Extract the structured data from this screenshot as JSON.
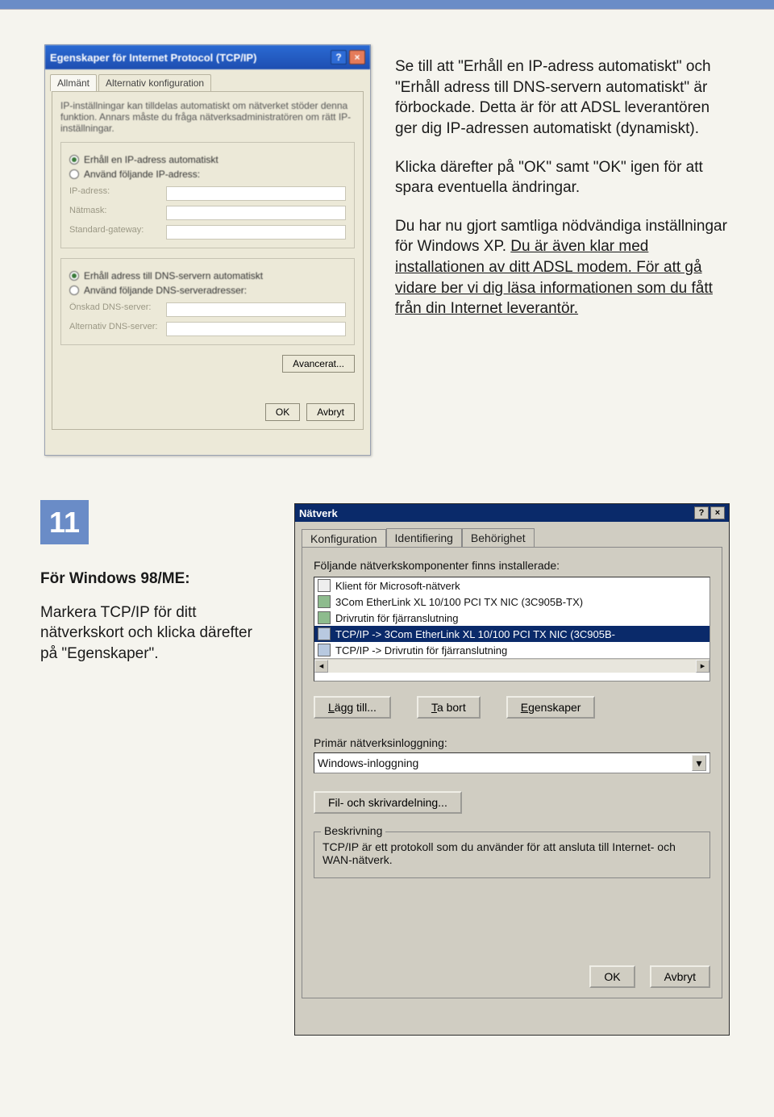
{
  "topbar": {},
  "xp": {
    "title": "Egenskaper för Internet Protocol (TCP/IP)",
    "tab_general": "Allmänt",
    "tab_alt": "Alternativ konfiguration",
    "blurb": "IP-inställningar kan tilldelas automatiskt om nätverket stöder denna funktion. Annars måste du fråga nätverksadministratören om rätt IP-inställningar.",
    "r_ip_auto": "Erhåll en IP-adress automatiskt",
    "r_ip_manual": "Använd följande IP-adress:",
    "lbl_ip": "IP-adress:",
    "lbl_mask": "Nätmask:",
    "lbl_gw": "Standard-gateway:",
    "r_dns_auto": "Erhåll adress till DNS-servern automatiskt",
    "r_dns_manual": "Använd följande DNS-serveradresser:",
    "lbl_dns1": "Önskad DNS-server:",
    "lbl_dns2": "Alternativ DNS-server:",
    "btn_adv": "Avancerat...",
    "btn_ok": "OK",
    "btn_cancel": "Avbryt"
  },
  "rtxt1": {
    "p1": "Se till att \"Erhåll en IP-adress automatiskt\" och \"Erhåll adress till DNS-servern automatiskt\" är förbockade. Detta är för att ADSL leverantören ger dig IP-adressen automatiskt (dynamiskt).",
    "p2": "Klicka därefter på \"OK\" samt \"OK\" igen för att spara eventuella ändringar.",
    "p3a": "Du har nu gjort samtliga nödvändiga inställningar för Windows XP. ",
    "p3b": "Du är även klar med installationen av ditt ADSL modem.",
    "p3c": " För att gå vidare ber vi dig läsa informationen som du fått från din Internet leverantör."
  },
  "step": {
    "num": "11"
  },
  "ltxt2": {
    "heading": "För Windows 98/ME:",
    "body": "Markera TCP/IP för ditt nätverkskort och klicka därefter på \"Egenskaper\"."
  },
  "w98": {
    "title": "Nätverk",
    "tab_conf": "Konfiguration",
    "tab_id": "Identifiering",
    "tab_sec": "Behörighet",
    "label_components": "Följande nätverkskomponenter finns installerade:",
    "items": [
      "Klient för Microsoft-nätverk",
      "3Com EtherLink XL 10/100 PCI TX NIC (3C905B-TX)",
      "Drivrutin för fjärranslutning",
      "TCP/IP -> 3Com EtherLink XL 10/100 PCI TX NIC (3C905B-",
      "TCP/IP -> Drivrutin för fjärranslutning"
    ],
    "btn_add": "Lägg till...",
    "btn_remove": "Ta bort",
    "btn_props": "Egenskaper",
    "label_logon": "Primär nätverksinloggning:",
    "logon_value": "Windows-inloggning",
    "btn_share": "Fil- och skrivardelning...",
    "grp_desc": "Beskrivning",
    "desc_text": "TCP/IP är ett protokoll som du använder för att ansluta till Internet- och WAN-nätverk.",
    "btn_ok": "OK",
    "btn_cancel": "Avbryt"
  }
}
